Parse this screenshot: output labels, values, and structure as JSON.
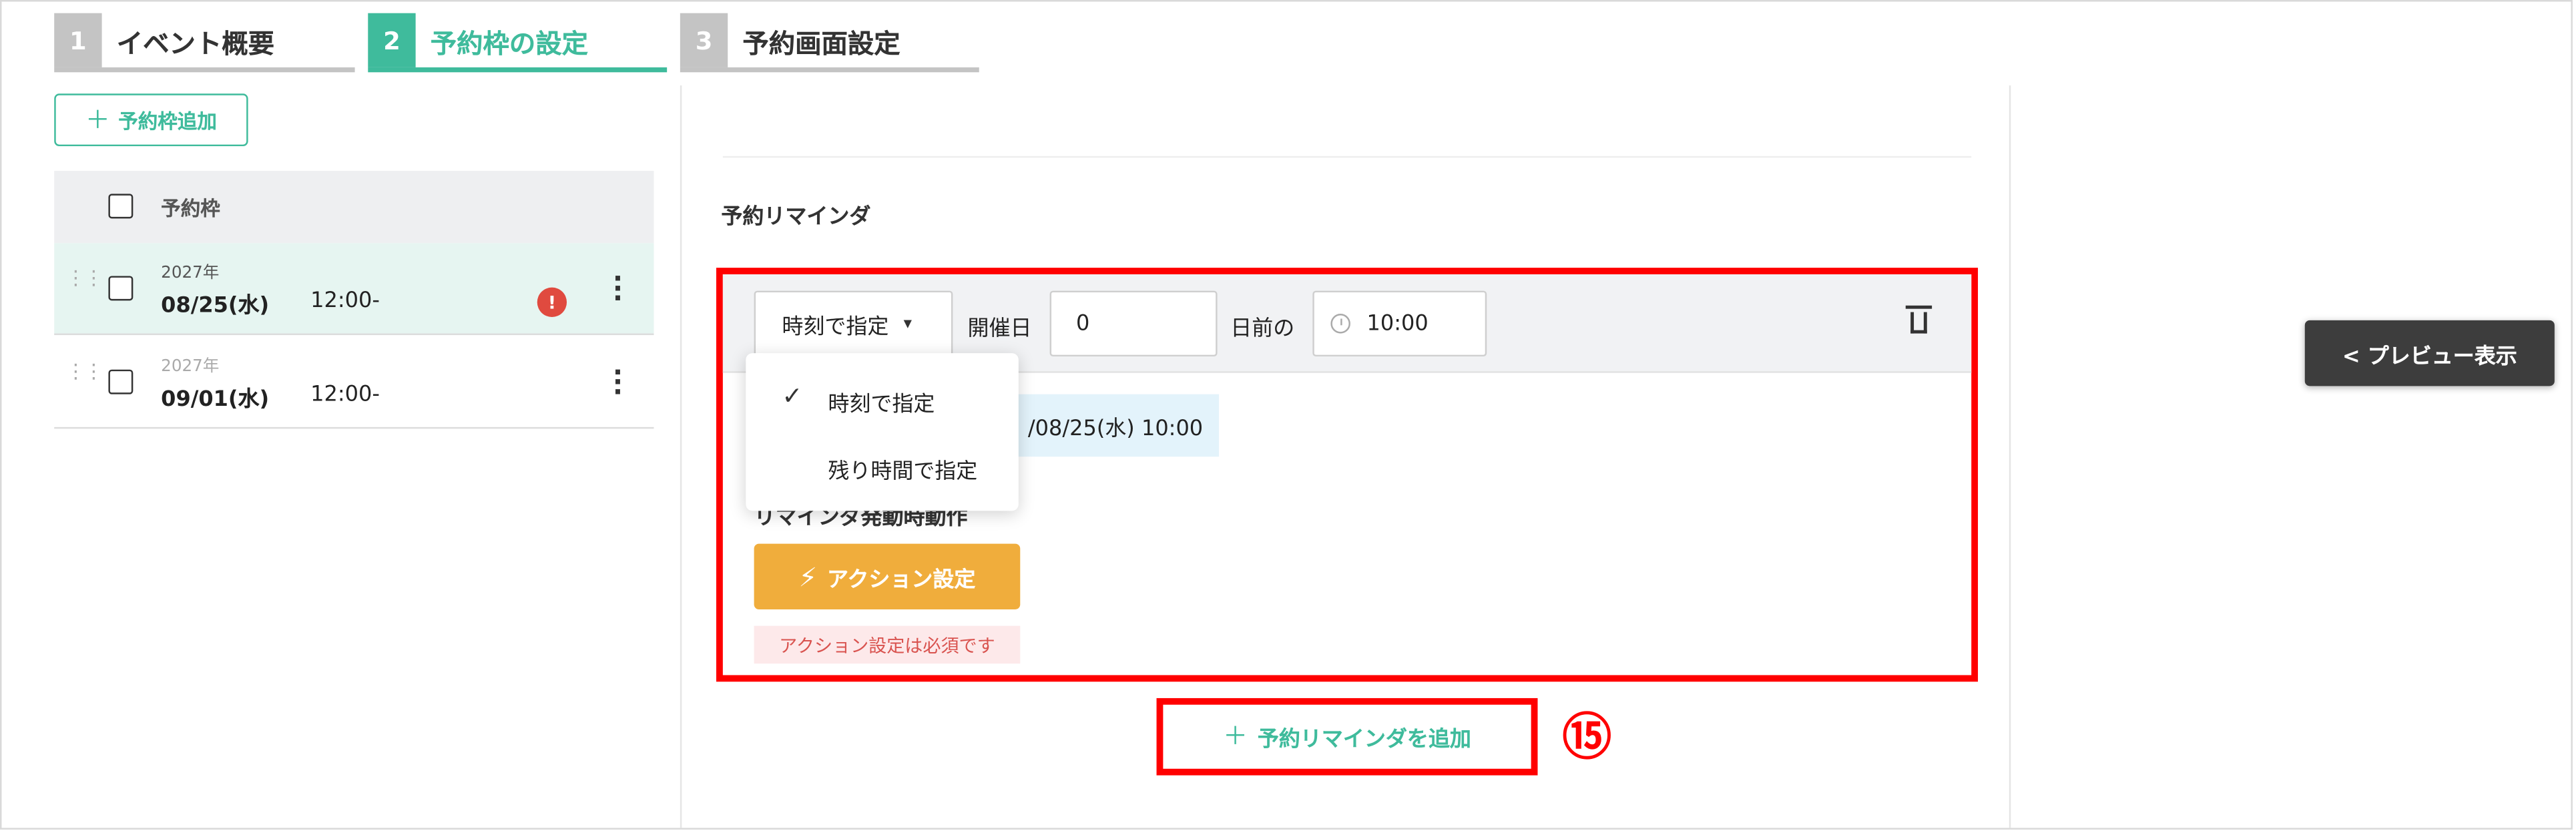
{
  "steps": [
    {
      "num": "1",
      "label": "イベント概要",
      "active": false
    },
    {
      "num": "2",
      "label": "予約枠の設定",
      "active": true
    },
    {
      "num": "3",
      "label": "予約画面設定",
      "active": false
    }
  ],
  "left": {
    "add_slot_label": "予約枠追加",
    "table_header": "予約枠",
    "rows": [
      {
        "year": "2027年",
        "date": "08/25(水)",
        "time": "12:00-",
        "error": "!"
      },
      {
        "year": "2027年",
        "date": "09/01(水)",
        "time": "12:00-"
      }
    ]
  },
  "reminder": {
    "section_title": "予約リマインダ",
    "mode_select": "時刻で指定",
    "label_event_day": "開催日",
    "days_value": "0",
    "label_days_before": "日前の",
    "time_value": "10:00",
    "date_preview": "/08/25(水) 10:00",
    "dropdown_options": [
      {
        "label": "時刻で指定",
        "checked": true
      },
      {
        "label": "残り時間で指定",
        "checked": false
      }
    ],
    "action_subhead": "リマインダ発動時動作",
    "action_button": "アクション設定",
    "action_error": "アクション設定は必須です",
    "add_reminder": "予約リマインダを追加",
    "annotation": "⑮"
  },
  "preview_button": "< プレビュー表示",
  "colors": {
    "accent": "#3fbb9c",
    "highlight": "#ff0000",
    "action": "#f0ad3c",
    "error": "#e04a3f"
  }
}
